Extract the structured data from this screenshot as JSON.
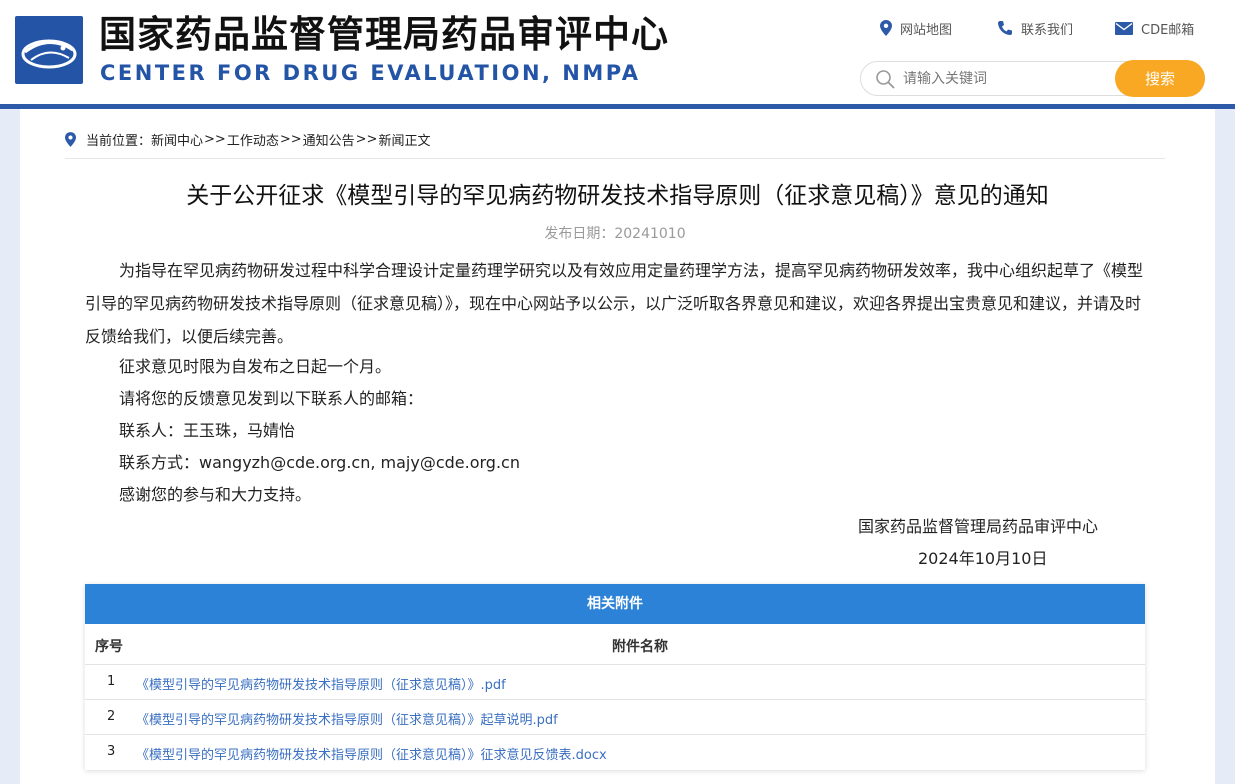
{
  "header": {
    "site_name_cn": "国家药品监督管理局药品审评中心",
    "site_name_en": "CENTER FOR DRUG EVALUATION, NMPA",
    "links": {
      "sitemap": "网站地图",
      "contact": "联系我们",
      "mail": "CDE邮箱"
    },
    "search": {
      "placeholder": "请输入关键词",
      "button": "搜索"
    },
    "brand_color": "#2454a6",
    "accent_color": "#f9a824"
  },
  "breadcrumb": {
    "label": "当前位置：",
    "items": [
      "新闻中心",
      "工作动态",
      "通知公告",
      "新闻正文"
    ],
    "separator": ">>"
  },
  "article": {
    "title": "关于公开征求《模型引导的罕见病药物研发技术指导原则（征求意见稿）》意见的通知",
    "date": "发布日期：20241010",
    "intro": "为指导在罕见病药物研发过程中科学合理设计定量药理学研究以及有效应用定量药理学方法，提高罕见病药物研发效率，我中心组织起草了《模型引导的罕见病药物研发技术指导原则（征求意见稿）》，现在中心网站予以公示，以广泛听取各界意见和建议，欢迎各界提出宝贵意见和建议，并请及时反馈给我们，以便后续完善。",
    "lines": [
      "征求意见时限为自发布之日起一个月。",
      "请将您的反馈意见发到以下联系人的邮箱：",
      "联系人：王玉珠，马婧怡",
      "联系方式：wangyzh@cde.org.cn, majy@cde.org.cn",
      "感谢您的参与和大力支持。"
    ],
    "signature_org": "国家药品监督管理局药品审评中心",
    "signature_date": "2024年10月10日"
  },
  "attachments": {
    "heading": "相关附件",
    "col_no": "序号",
    "col_name": "附件名称",
    "rows": [
      {
        "no": "1",
        "name": "《模型引导的罕见病药物研发技术指导原则（征求意见稿）》.pdf"
      },
      {
        "no": "2",
        "name": "《模型引导的罕见病药物研发技术指导原则（征求意见稿）》起草说明.pdf"
      },
      {
        "no": "3",
        "name": "《模型引导的罕见病药物研发技术指导原则（征求意见稿）》征求意见反馈表.docx"
      }
    ]
  }
}
